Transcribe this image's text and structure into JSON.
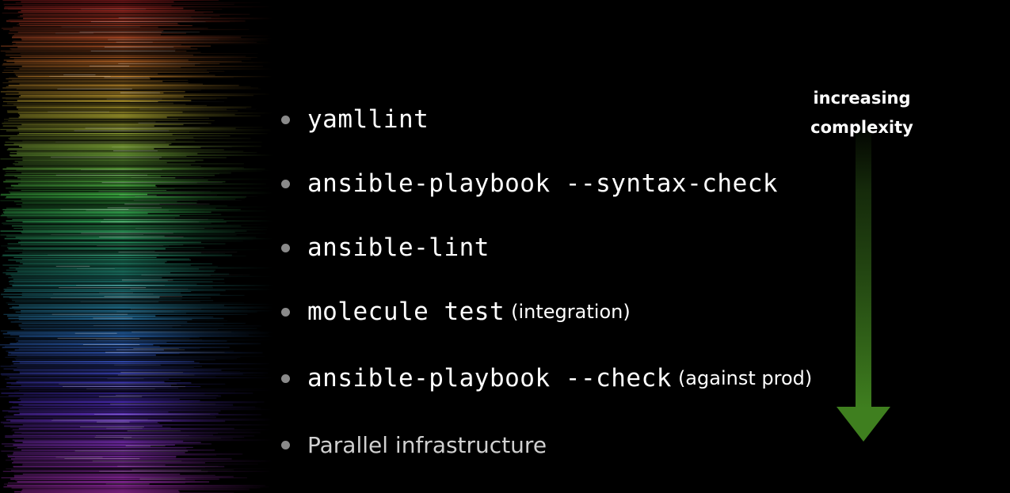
{
  "slide": {
    "items": [
      {
        "code": "yamllint",
        "note": ""
      },
      {
        "code": "ansible-playbook --syntax-check",
        "note": ""
      },
      {
        "code": "ansible-lint",
        "note": ""
      },
      {
        "code": "molecule test",
        "note": "(integration)"
      },
      {
        "code": "ansible-playbook --check",
        "note": "(against prod)"
      },
      {
        "text": "Parallel infrastructure"
      }
    ],
    "complexity": {
      "line1": "increasing",
      "line2": "complexity"
    }
  },
  "colors": {
    "background": "#000000",
    "bullet": "#8a8a8a",
    "arrow": "#3f7f1f",
    "text": "#ffffff",
    "muted_text": "#d0d0d0"
  }
}
